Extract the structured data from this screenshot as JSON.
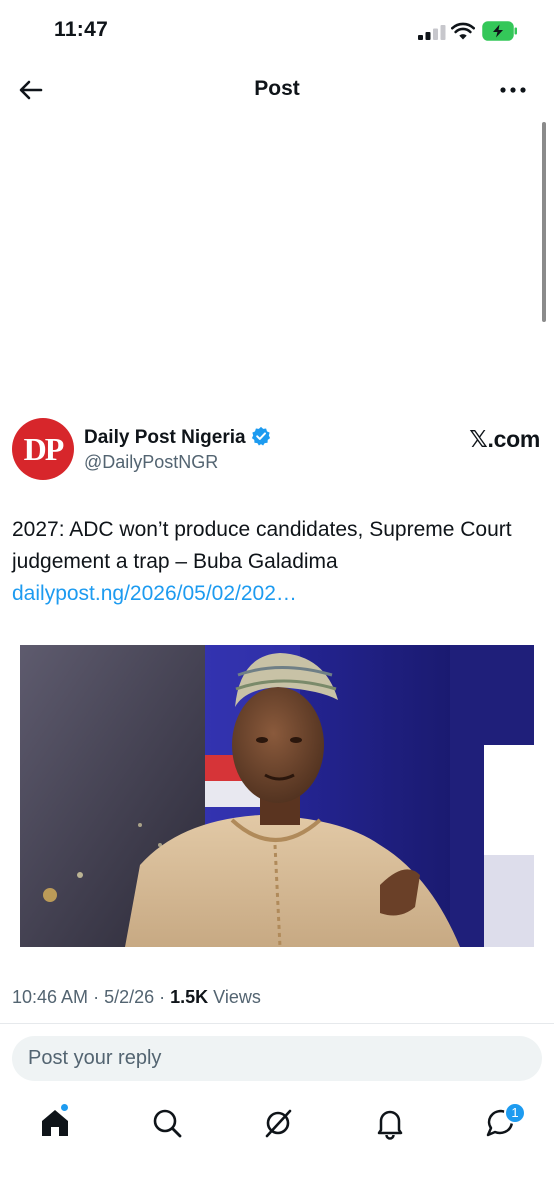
{
  "status": {
    "time": "11:47"
  },
  "header": {
    "title": "Post"
  },
  "embed": {
    "avatar_initials": "DP",
    "display_name": "Daily Post Nigeria",
    "handle": "@DailyPostNGR",
    "source": "𝕏.com",
    "text": "2027: ADC won’t produce candidates, Supreme Court judgement a trap – Buba Galadima",
    "link": "dailypost.ng/2026/05/02/202…"
  },
  "meta": {
    "time": "10:46 AM",
    "date": "5/2/26",
    "views_count": "1.5K",
    "views_label": "Views"
  },
  "reply": {
    "placeholder": "Post your reply"
  },
  "tabs": {
    "messages_badge": "1"
  },
  "colors": {
    "accent": "#1d9bf0",
    "brand_red": "#d7262b",
    "text": "#0f1419",
    "secondary": "#536471"
  },
  "icons": [
    "back-arrow-icon",
    "more-icon",
    "verified-icon",
    "home-icon",
    "search-icon",
    "grok-icon",
    "notifications-icon",
    "messages-icon"
  ]
}
